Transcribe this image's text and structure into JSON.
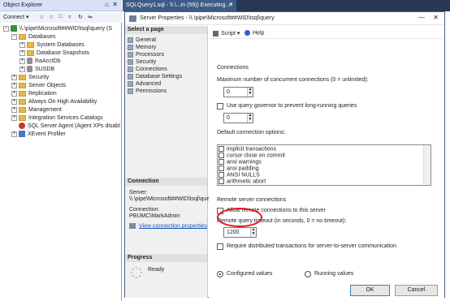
{
  "object_explorer": {
    "title": "Object Explorer",
    "pin_icon": "⌂",
    "close_icon": "✕",
    "toolbar": {
      "connect": "Connect ▾",
      "icons": [
        "☆",
        "☆",
        "□",
        "▿",
        "↻",
        "⇋"
      ]
    },
    "tree": [
      {
        "label": "\\\\.\\pipe\\Microsoft##WID\\tsql\\query (S",
        "icon": "server",
        "expander": "−",
        "indent": 0
      },
      {
        "label": "Databases",
        "icon": "folder",
        "expander": "−",
        "indent": 1
      },
      {
        "label": "System Databases",
        "icon": "folder",
        "expander": "+",
        "indent": 2
      },
      {
        "label": "Database Snapshots",
        "icon": "folder",
        "expander": "+",
        "indent": 2
      },
      {
        "label": "RaAcctDb",
        "icon": "database",
        "expander": "+",
        "indent": 2
      },
      {
        "label": "SUSDB",
        "icon": "database",
        "expander": "+",
        "indent": 2
      },
      {
        "label": "Security",
        "icon": "folder",
        "expander": "+",
        "indent": 1
      },
      {
        "label": "Server Objects",
        "icon": "folder",
        "expander": "+",
        "indent": 1
      },
      {
        "label": "Replication",
        "icon": "folder",
        "expander": "+",
        "indent": 1
      },
      {
        "label": "Always On High Availability",
        "icon": "folder",
        "expander": "+",
        "indent": 1
      },
      {
        "label": "Management",
        "icon": "folder",
        "expander": "+",
        "indent": 1
      },
      {
        "label": "Integration Services Catalogs",
        "icon": "folder",
        "expander": "+",
        "indent": 1
      },
      {
        "label": "SQL Server Agent (Agent XPs disabl",
        "icon": "agent",
        "expander": "",
        "indent": 1
      },
      {
        "label": "XEvent Profiler",
        "icon": "xevent",
        "expander": "+",
        "indent": 1
      }
    ]
  },
  "tab": {
    "label": "SQLQuery1.sql - \\\\.\\...in (59)) Executing...*",
    "close": "✕"
  },
  "dialog": {
    "title": "Server Properties - \\\\.\\pipe\\Microsoft##WID\\tsql\\query",
    "minimize": "—",
    "close": "✕",
    "select_page_header": "Select a page",
    "pages": [
      "General",
      "Memory",
      "Processors",
      "Security",
      "Connections",
      "Database Settings",
      "Advanced",
      "Permissions"
    ],
    "connection": {
      "header": "Connection",
      "server_label": "Server:",
      "server_value": "\\\\.\\pipe\\Microsoft##WID\\tsql\\que",
      "connection_label": "Connection:",
      "connection_value": "PBUMC\\MarkAdmin",
      "view_link": "View connection properties"
    },
    "progress": {
      "header": "Progress",
      "status": "Ready"
    },
    "toolbar": {
      "script": "Script",
      "help": "Help"
    },
    "connections_section": "Connections",
    "max_conn_label": "Maximum number of concurrent connections (0 = unlimited):",
    "max_conn_value": "0",
    "query_governor_label": "Use query governor to prevent long-running queries",
    "query_governor_value": "0",
    "default_options_label": "Default connection options:",
    "options": [
      "implicit transactions",
      "cursor close on commit",
      "ansi warnings",
      "ansi padding",
      "ANSI NULLS",
      "arithmetic abort"
    ],
    "remote_section": "Remote server connections",
    "allow_remote_label": "Allow remote connections to this server",
    "remote_timeout_label": "Remote query timeout (in seconds, 0 = no timeout):",
    "remote_timeout_value": "1200",
    "require_distributed_label": "Require distributed transactions for server-to-server communication",
    "configured_values": "Configured values",
    "running_values": "Running values",
    "ok_button": "OK",
    "cancel_button": "Cancel"
  },
  "colors": {
    "accent": "#3f5a86",
    "highlight_ring": "#e0141b",
    "link": "#1a55c4"
  }
}
